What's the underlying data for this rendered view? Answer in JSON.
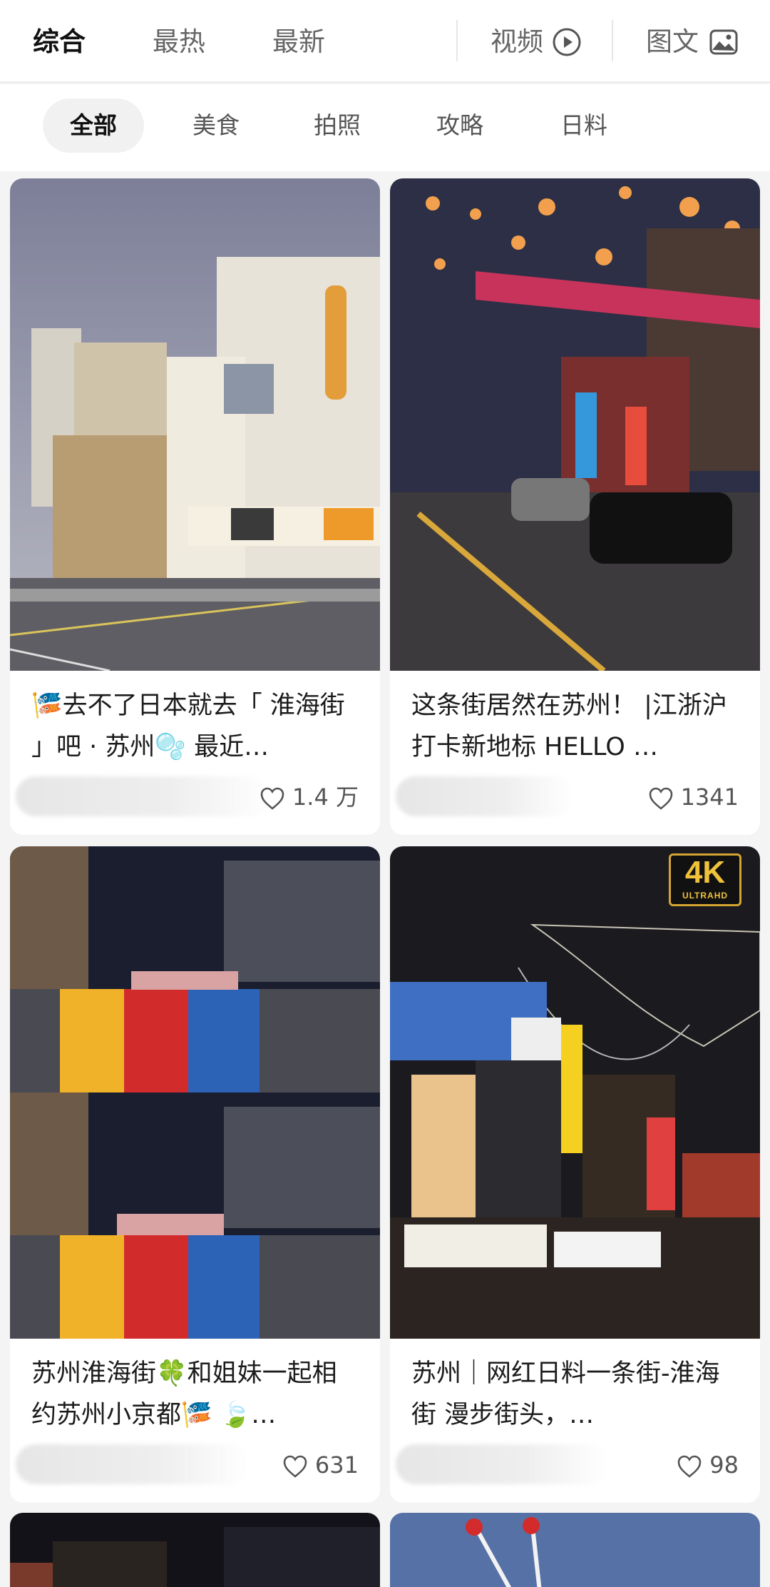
{
  "top_tabs": {
    "comprehensive": "综合",
    "hottest": "最热",
    "newest": "最新",
    "video": "视频",
    "image_text": "图文"
  },
  "chips": [
    "全部",
    "美食",
    "拍照",
    "攻略",
    "日料"
  ],
  "cards": [
    {
      "title_prefix": "去不了日本就去「 淮海街 」吧 · 苏州",
      "title_suffix": " 最近…",
      "likes": "1.4 万"
    },
    {
      "title": "这条街居然在苏州！ |江浙沪打卡新地标 HELLO …",
      "likes": "1341"
    },
    {
      "title": "苏州淮海街🍀和姐妹一起相约苏州小京都🎏 🍃…",
      "likes": "631"
    },
    {
      "title": "苏州｜网红日料一条街-淮海街 漫步街头，…",
      "likes": "98",
      "badge_big": "4K",
      "badge_small": "ULTRAHD"
    }
  ],
  "icons": {
    "video": "play-circle-icon",
    "image_text": "image-icon",
    "like": "heart-icon"
  },
  "colors": {
    "active_chip_bg": "#f1f1f1",
    "page_bg": "#f4f4f4"
  }
}
